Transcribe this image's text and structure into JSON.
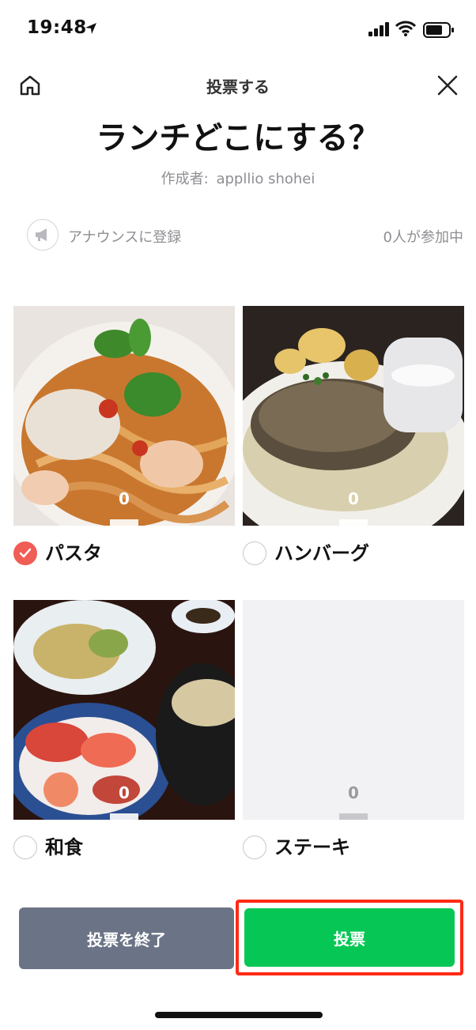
{
  "status_bar": {
    "time": "19:48"
  },
  "header": {
    "title": "投票する"
  },
  "poll": {
    "title": "ランチどこにする？",
    "creator_label": "作成者:",
    "creator_name": "appllio shohei",
    "announce_label": "アナウンスに登録",
    "participants": "0人が参加中"
  },
  "options": [
    {
      "label": "パスタ",
      "count": "0",
      "selected": true,
      "image": "pasta-photo"
    },
    {
      "label": "ハンバーグ",
      "count": "0",
      "selected": false,
      "image": "hamburg-steak-photo"
    },
    {
      "label": "和食",
      "count": "0",
      "selected": false,
      "image": "japanese-meal-photo"
    },
    {
      "label": "ステーキ",
      "count": "0",
      "selected": false,
      "image": ""
    }
  ],
  "footer": {
    "end_label": "投票を終了",
    "vote_label": "投票"
  },
  "colors": {
    "vote_green": "#06c755",
    "end_gray": "#6b7486",
    "check_red": "#f05d55",
    "highlight_red": "#ff2a16"
  }
}
